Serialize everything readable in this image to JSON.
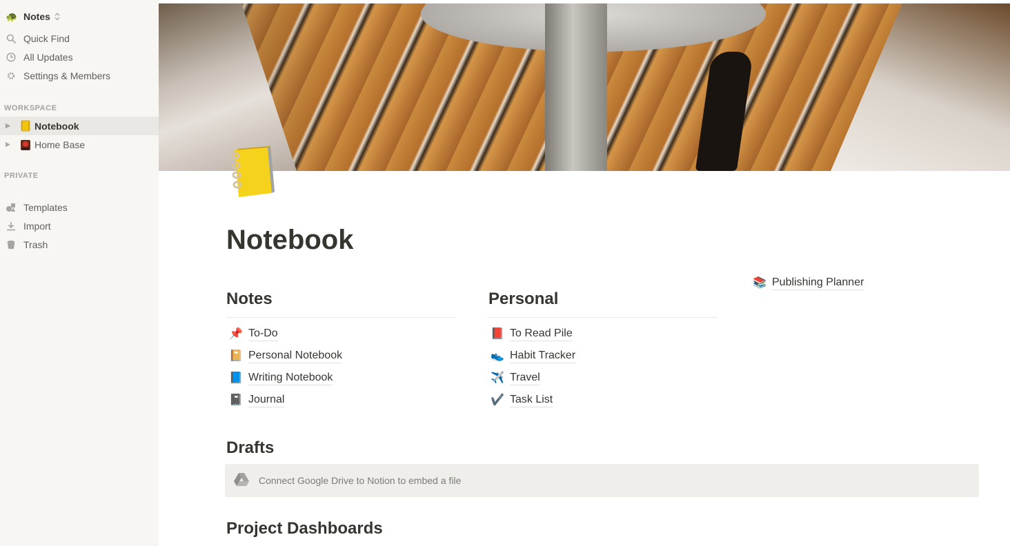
{
  "sidebar": {
    "workspace": {
      "icon": "turtle-emoji",
      "name": "Notes"
    },
    "nav": [
      {
        "icon": "search-icon",
        "label": "Quick Find"
      },
      {
        "icon": "clock-icon",
        "label": "All Updates"
      },
      {
        "icon": "gear-icon",
        "label": "Settings & Members"
      }
    ],
    "sections": {
      "workspace_label": "WORKSPACE",
      "private_label": "PRIVATE"
    },
    "workspace_pages": [
      {
        "emoji": "📒",
        "label": "Notebook",
        "active": true
      },
      {
        "emoji": "🏮",
        "label": "Home Base",
        "active": false
      }
    ],
    "footer": [
      {
        "icon": "templates-icon",
        "label": "Templates"
      },
      {
        "icon": "download-icon",
        "label": "Import"
      },
      {
        "icon": "trash-icon",
        "label": "Trash"
      }
    ]
  },
  "page": {
    "icon": "notebook-emoji",
    "title": "Notebook",
    "columns": [
      {
        "heading": "Notes",
        "links": [
          {
            "emoji": "📌",
            "label": "To-Do"
          },
          {
            "emoji": "📔",
            "label": "Personal Notebook"
          },
          {
            "emoji": "📘",
            "label": "Writing Notebook"
          },
          {
            "emoji": "📓",
            "label": "Journal"
          }
        ]
      },
      {
        "heading": "Personal",
        "links": [
          {
            "emoji": "📕",
            "label": "To Read Pile"
          },
          {
            "emoji": "👟",
            "label": "Habit Tracker"
          },
          {
            "emoji": "✈️",
            "label": "Travel"
          },
          {
            "emoji": "✔️",
            "label": "Task List"
          }
        ]
      },
      {
        "heading": "",
        "links": [
          {
            "emoji": "📚",
            "label": "Publishing Planner"
          }
        ]
      }
    ],
    "drafts": {
      "heading": "Drafts",
      "embed_text": "Connect Google Drive to Notion to embed a file"
    },
    "project_dashboards": {
      "heading": "Project Dashboards"
    }
  }
}
